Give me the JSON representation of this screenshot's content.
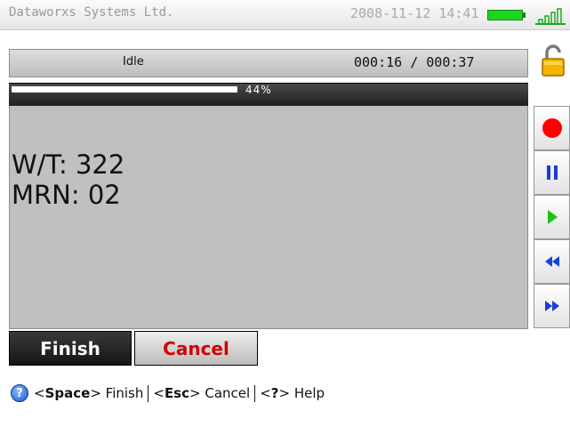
{
  "header": {
    "company": "Dataworxs Systems Ltd.",
    "datetime": "2008-11-12  14:41",
    "battery_icon": "battery-full-icon",
    "signal_icon": "signal-strength-icon"
  },
  "status": {
    "state": "Idle",
    "time": "000:16 / 000:37",
    "lock_icon": "padlock-icon"
  },
  "progress": {
    "percent": 44,
    "label": "44%"
  },
  "display": {
    "line1": "W/T: 322",
    "line2": "MRN: 02"
  },
  "controls": [
    {
      "name": "record",
      "icon": "record-icon",
      "color": "#ff0000"
    },
    {
      "name": "pause",
      "icon": "pause-icon",
      "color": "#1a3fd9"
    },
    {
      "name": "play",
      "icon": "play-icon",
      "color": "#18c418"
    },
    {
      "name": "rewind",
      "icon": "rewind-icon",
      "color": "#1a3fd9"
    },
    {
      "name": "fast-forward",
      "icon": "fast-forward-icon",
      "color": "#1a3fd9"
    }
  ],
  "actions": {
    "finish": "Finish",
    "cancel": "Cancel"
  },
  "help": {
    "icon": "help-icon",
    "space_key": "Space",
    "space_action": "Finish",
    "esc_key": "Esc",
    "esc_action": "Cancel",
    "help_key": "?",
    "help_action": "Help"
  }
}
